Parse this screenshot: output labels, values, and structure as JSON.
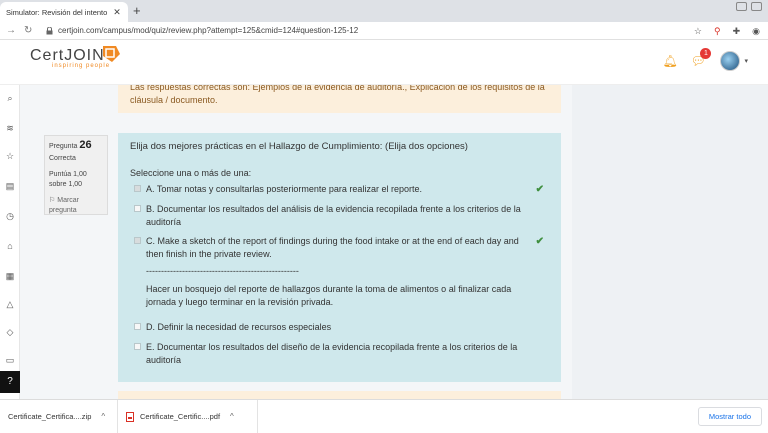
{
  "browser": {
    "tab_title": "Simulator: Revisión del intento",
    "tab_close": "✕",
    "new_tab": "+",
    "url": "certjoin.com/campus/mod/quiz/review.php?attempt=125&cmid=124#question-125-12"
  },
  "header": {
    "logo_text_a": "Cert",
    "logo_text_b": "JOIN",
    "logo_sub": "inspiring people",
    "notification_count": "1",
    "colors": {
      "accent": "#f08a24",
      "badge": "#e53935"
    }
  },
  "feedback": {
    "text": "Las respuestas correctas son: Ejemplos de la evidencia de auditoría., Explicación de los requisitos de la cláusula / documento."
  },
  "question_info": {
    "label": "Pregunta",
    "number": "26",
    "status": "Correcta",
    "score": "Puntúa 1,00 sobre 1,00",
    "flag": "Marcar pregunta"
  },
  "question": {
    "text": "Elija dos mejores prácticas en el Hallazgo de Cumplimiento: (Elija dos opciones)",
    "prompt": "Seleccione una o más de una:",
    "options": [
      {
        "text": "A. Tomar notas y consultarlas posteriormente para realizar el reporte.",
        "checked": true,
        "correct": true
      },
      {
        "text": "B. Documentar los resultados del análisis de la evidencia recopilada frente a los criterios de la auditoría",
        "checked": false,
        "correct": false
      },
      {
        "text": "C. Make a sketch of the report of findings during the food intake or at the end of each day and then finish in the private review.",
        "checked": true,
        "correct": true
      },
      {
        "text": "---------------------------------------------------",
        "checked": false,
        "correct": false
      },
      {
        "text": "Hacer un bosquejo del reporte de hallazgos durante la toma de alimentos o al finalizar cada jornada y luego terminar en la revisión privada.",
        "checked": false,
        "correct": false
      },
      {
        "text": "D. Definir la necesidad de recursos especiales",
        "checked": false,
        "correct": false
      },
      {
        "text": "E. Documentar los resultados del diseño de la evidencia recopilada frente a los criterios de la auditoría",
        "checked": false,
        "correct": false
      }
    ],
    "tick": "✔"
  },
  "downloads": {
    "items": [
      "Certificate_Certifica....zip",
      "Certificate_Certific....pdf"
    ],
    "chevron": "^",
    "show_all": "Mostrar todo"
  }
}
